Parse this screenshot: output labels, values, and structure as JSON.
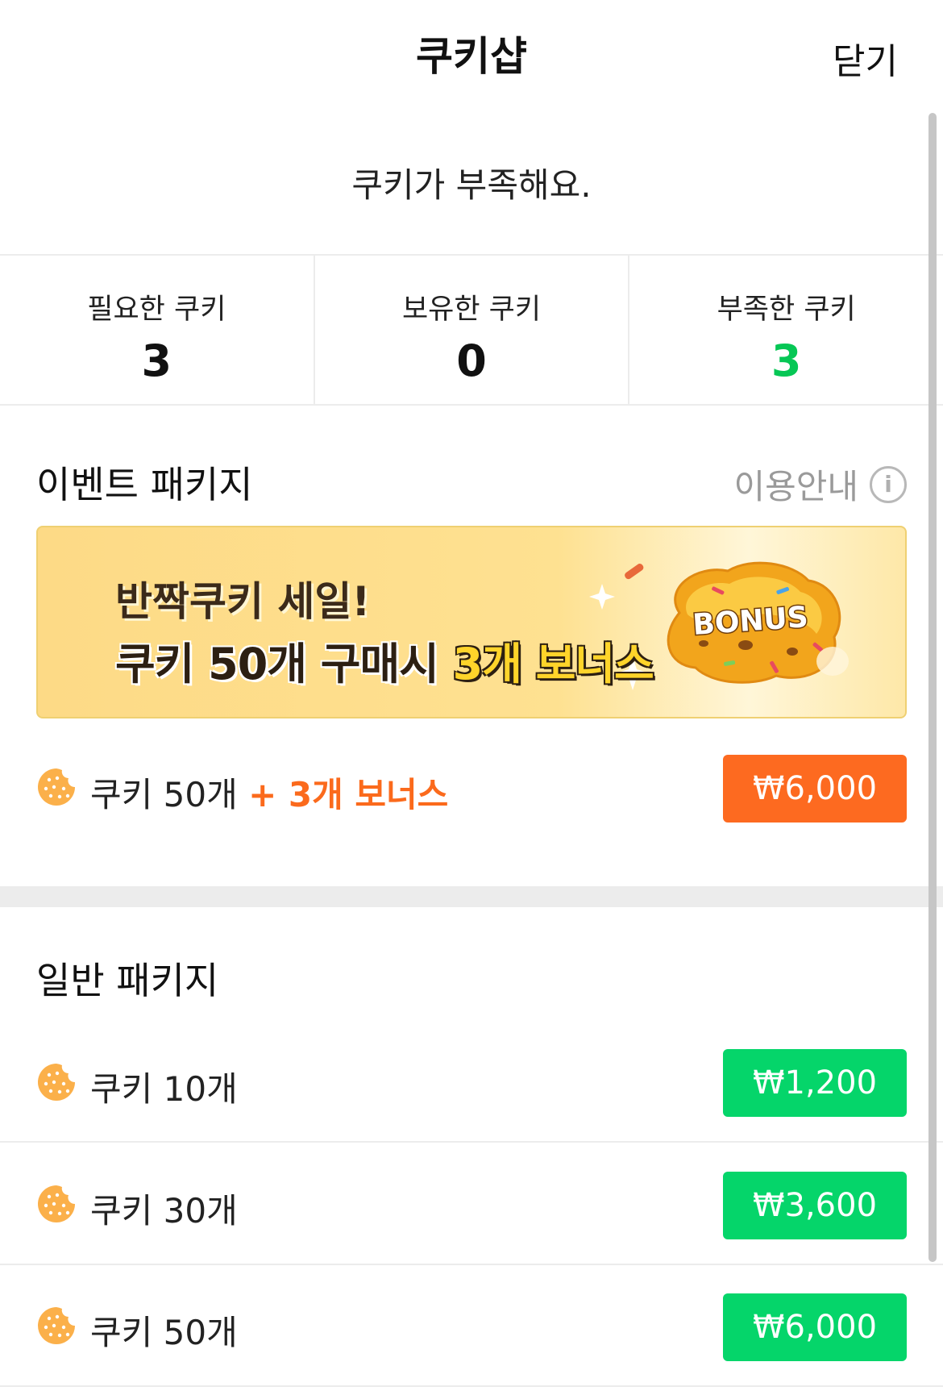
{
  "header": {
    "title": "쿠키샵",
    "close_label": "닫기"
  },
  "message": "쿠키가 부족해요.",
  "stats": [
    {
      "label": "필요한 쿠키",
      "value": "3"
    },
    {
      "label": "보유한 쿠키",
      "value": "0"
    },
    {
      "label": "부족한 쿠키",
      "value": "3"
    }
  ],
  "colors": {
    "shortage": "#06c755",
    "event_button": "#fd6a20",
    "regular_button": "#05d56a",
    "bonus_text": "#fb6a1c"
  },
  "event_section": {
    "title": "이벤트 패키지",
    "guide_label": "이용안내",
    "guide_icon": "info-icon",
    "banner": {
      "line1": "반짝쿠키 세일!",
      "line2_prefix": "쿠키 50개 구매시 ",
      "line2_highlight": "3개 보너스",
      "badge": "BONUS"
    },
    "package": {
      "label": "쿠키 50개",
      "bonus": "+ 3개 보너스",
      "price": "₩6,000",
      "icon": "cookie-icon"
    }
  },
  "regular_section": {
    "title": "일반 패키지",
    "packages": [
      {
        "label": "쿠키 10개",
        "price": "₩1,200",
        "icon": "cookie-icon"
      },
      {
        "label": "쿠키 30개",
        "price": "₩3,600",
        "icon": "cookie-icon"
      },
      {
        "label": "쿠키 50개",
        "price": "₩6,000",
        "icon": "cookie-icon"
      }
    ]
  }
}
